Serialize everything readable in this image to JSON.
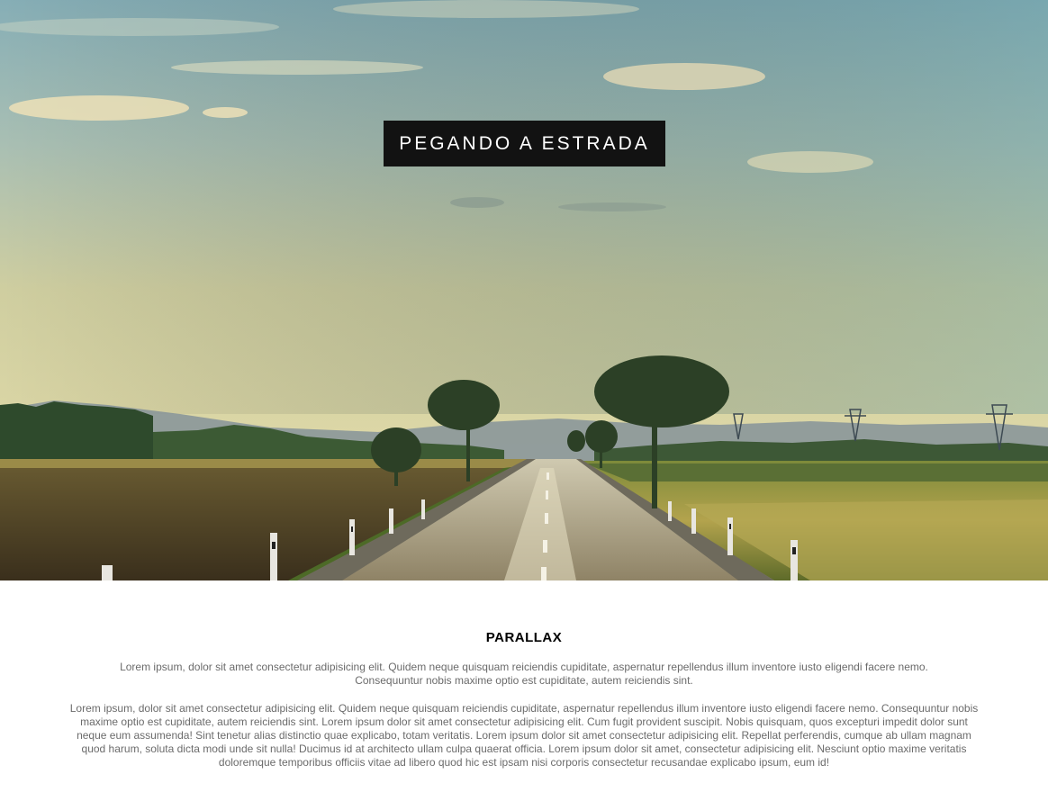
{
  "hero": {
    "title": "PEGANDO A ESTRADA",
    "image_description_icon": "road-landscape-photo"
  },
  "section": {
    "title": "PARALLAX",
    "paragraphs": [
      "Lorem ipsum, dolor sit amet consectetur adipisicing elit. Quidem neque quisquam reiciendis cupiditate, aspernatur repellendus illum inventore iusto eligendi facere nemo. Consequuntur nobis maxime optio est cupiditate, autem reiciendis sint.",
      "Lorem ipsum, dolor sit amet consectetur adipisicing elit. Quidem neque quisquam reiciendis cupiditate, aspernatur repellendus illum inventore iusto eligendi facere nemo. Consequuntur nobis maxime optio est cupiditate, autem reiciendis sint. Lorem ipsum dolor sit amet consectetur adipisicing elit. Cum fugit provident suscipit. Nobis quisquam, quos excepturi impedit dolor sunt neque eum assumenda! Sint tenetur alias distinctio quae explicabo, totam veritatis. Lorem ipsum dolor sit amet consectetur adipisicing elit. Repellat perferendis, cumque ab ullam magnam quod harum, soluta dicta modi unde sit nulla! Ducimus id at architecto ullam culpa quaerat officia. Lorem ipsum dolor sit amet, consectetur adipisicing elit. Nesciunt optio maxime veritatis doloremque temporibus officiis vitae ad libero quod hic est ipsam nisi corporis consectetur recusandae explicabo ipsum, eum id!"
    ]
  },
  "colors": {
    "title_bg": "#121212",
    "title_text": "#ffffff",
    "body_text": "#6b6b6b",
    "heading_text": "#000000"
  }
}
